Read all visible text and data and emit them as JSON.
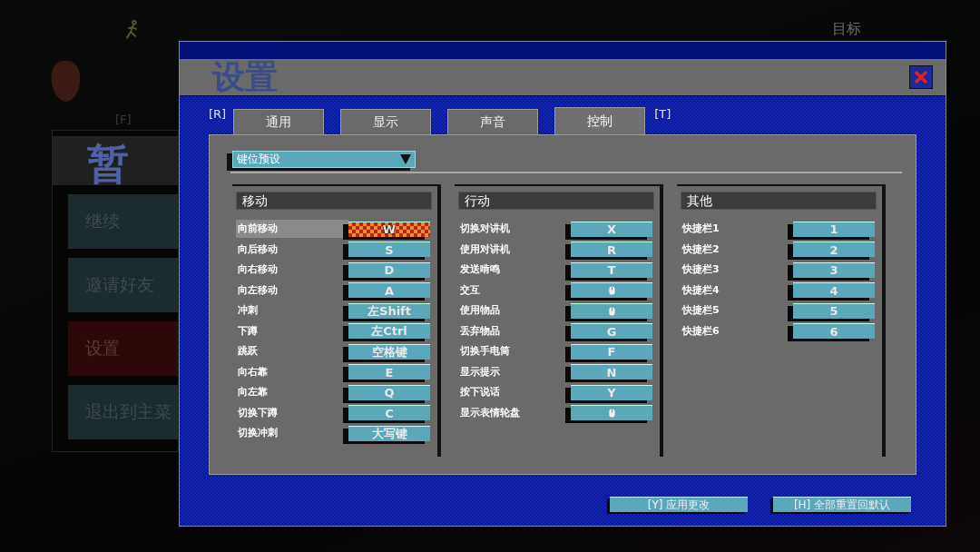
{
  "background": {
    "objective_label": "目标",
    "hint_key": "[F]",
    "pause_menu": {
      "title": "暂",
      "items": [
        {
          "label": "继续",
          "selected": false
        },
        {
          "label": "邀请好友",
          "selected": false
        },
        {
          "label": "设置",
          "selected": true
        },
        {
          "label": "退出到主菜",
          "selected": false
        }
      ]
    }
  },
  "settings": {
    "title": "设置",
    "tab_prev_key": "[R]",
    "tab_next_key": "[T]",
    "tabs": [
      {
        "label": "通用",
        "selected": false
      },
      {
        "label": "显示",
        "selected": false
      },
      {
        "label": "声音",
        "selected": false
      },
      {
        "label": "控制",
        "selected": true
      }
    ],
    "preset_dropdown": {
      "value": "键位预设"
    },
    "columns": [
      {
        "title": "移动",
        "bindings": [
          {
            "action": "向前移动",
            "kind": "key",
            "key": "W",
            "selected": true
          },
          {
            "action": "向后移动",
            "kind": "key",
            "key": "S",
            "selected": false
          },
          {
            "action": "向右移动",
            "kind": "key",
            "key": "D",
            "selected": false
          },
          {
            "action": "向左移动",
            "kind": "key",
            "key": "A",
            "selected": false
          },
          {
            "action": "冲刺",
            "kind": "key",
            "key": "左Shift",
            "selected": false
          },
          {
            "action": "下蹲",
            "kind": "key",
            "key": "左Ctrl",
            "selected": false
          },
          {
            "action": "跳跃",
            "kind": "key",
            "key": "空格键",
            "selected": false
          },
          {
            "action": "向右靠",
            "kind": "key",
            "key": "E",
            "selected": false
          },
          {
            "action": "向左靠",
            "kind": "key",
            "key": "Q",
            "selected": false
          },
          {
            "action": "切换下蹲",
            "kind": "key",
            "key": "C",
            "selected": false
          },
          {
            "action": "切换冲刺",
            "kind": "key",
            "key": "大写键",
            "selected": false
          }
        ]
      },
      {
        "title": "行动",
        "bindings": [
          {
            "action": "切换对讲机",
            "kind": "key",
            "key": "X",
            "selected": false
          },
          {
            "action": "使用对讲机",
            "kind": "key",
            "key": "R",
            "selected": false
          },
          {
            "action": "发送啃鸣",
            "kind": "key",
            "key": "T",
            "selected": false
          },
          {
            "action": "交互",
            "kind": "mouse",
            "selected": false
          },
          {
            "action": "使用物品",
            "kind": "mouse",
            "selected": false
          },
          {
            "action": "丢弃物品",
            "kind": "key",
            "key": "G",
            "selected": false
          },
          {
            "action": "切换手电筒",
            "kind": "key",
            "key": "F",
            "selected": false
          },
          {
            "action": "显示提示",
            "kind": "key",
            "key": "N",
            "selected": false
          },
          {
            "action": "按下说话",
            "kind": "key",
            "key": "Y",
            "selected": false
          },
          {
            "action": "显示表情轮盘",
            "kind": "mouse",
            "selected": false
          }
        ]
      },
      {
        "title": "其他",
        "bindings": [
          {
            "action": "快捷栏1",
            "kind": "key",
            "key": "1",
            "selected": false
          },
          {
            "action": "快捷栏2",
            "kind": "key",
            "key": "2",
            "selected": false
          },
          {
            "action": "快捷栏3",
            "kind": "key",
            "key": "3",
            "selected": false
          },
          {
            "action": "快捷栏4",
            "kind": "key",
            "key": "4",
            "selected": false
          },
          {
            "action": "快捷栏5",
            "kind": "key",
            "key": "5",
            "selected": false
          },
          {
            "action": "快捷栏6",
            "kind": "key",
            "key": "6",
            "selected": false
          }
        ]
      }
    ],
    "buttons": [
      "[Y] 应用更改",
      "[H] 全部重置回默认"
    ]
  }
}
